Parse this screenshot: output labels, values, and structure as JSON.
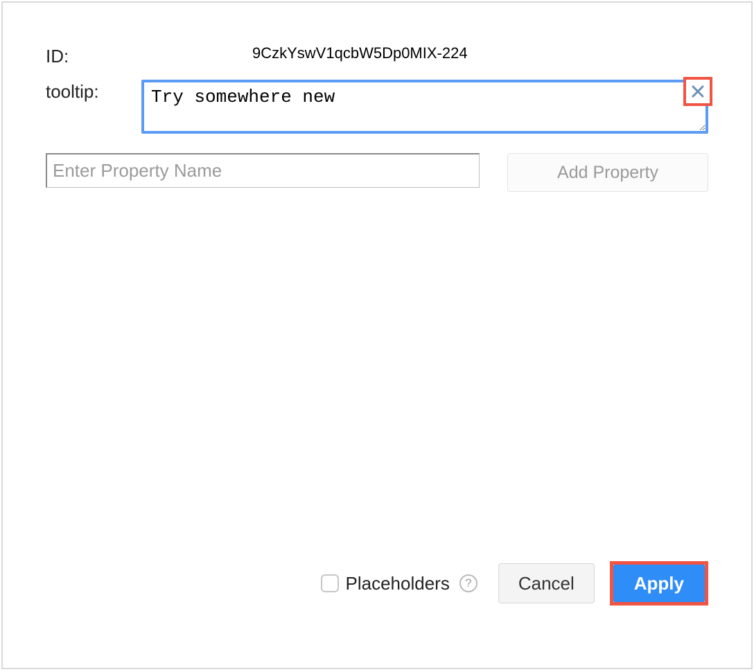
{
  "fields": {
    "id_label": "ID:",
    "id_value": "9CzkYswV1qcbW5Dp0MIX-224",
    "tooltip_label": "tooltip:",
    "tooltip_value": "Try somewhere new"
  },
  "add_property": {
    "placeholder": "Enter Property Name",
    "button_label": "Add Property"
  },
  "footer": {
    "placeholders_label": "Placeholders",
    "placeholders_checked": false,
    "cancel_label": "Cancel",
    "apply_label": "Apply"
  },
  "colors": {
    "focus_border": "#5b9bf3",
    "highlight_border": "#f15443",
    "primary_button": "#2e8df7"
  }
}
